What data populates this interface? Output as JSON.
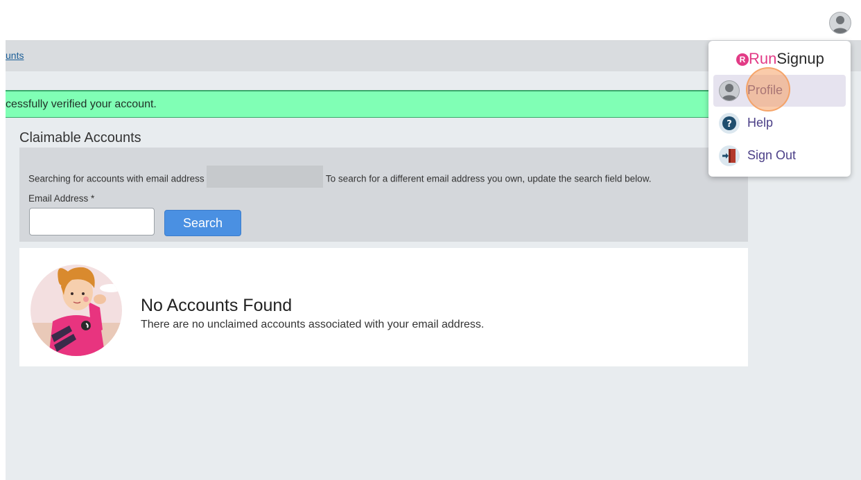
{
  "breadcrumb": {
    "link": "unts"
  },
  "alert": {
    "message": "cessfully verified your account."
  },
  "claimable": {
    "title": "Claimable Accounts",
    "search_intro": "Searching for accounts with email address",
    "search_hint": "To search for a different email address you own, update the search field below.",
    "email_label": "Email Address *",
    "email_value": "",
    "search_button": "Search"
  },
  "results": {
    "title": "No Accounts Found",
    "message": "There are no unclaimed accounts associated with your email address."
  },
  "dropdown": {
    "brand_badge": "R",
    "brand_run": "Run",
    "brand_signup": "Signup",
    "items": [
      {
        "label": "Profile",
        "icon": "avatar-icon"
      },
      {
        "label": "Help",
        "icon": "question-icon"
      },
      {
        "label": "Sign Out",
        "icon": "door-exit-icon"
      }
    ]
  },
  "colors": {
    "alert_bg": "#80ffb5",
    "button_blue": "#4a90e2",
    "brand_pink": "#e23b86",
    "menu_text": "#4b3f87",
    "highlight": "#f5a064"
  }
}
